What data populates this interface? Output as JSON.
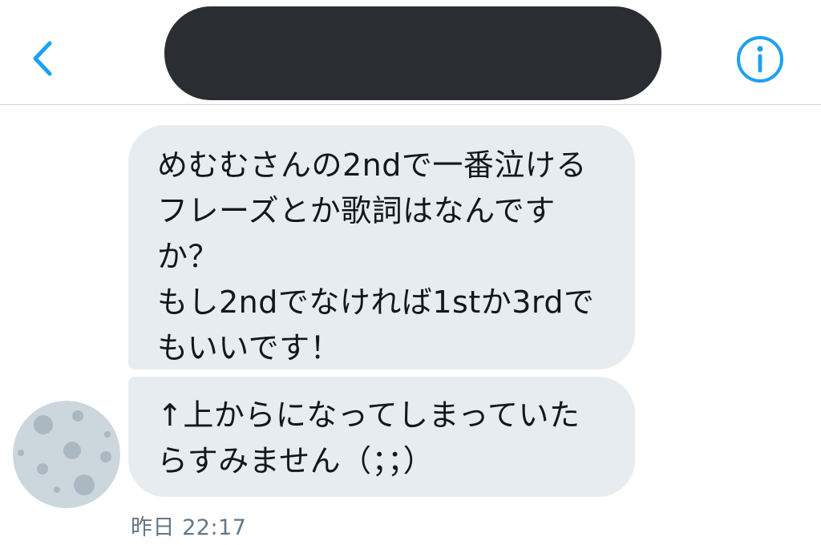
{
  "header": {
    "back_icon": "chevron-left-icon",
    "info_icon": "info-circle-icon",
    "accent_color": "#1da1f2"
  },
  "conversation": {
    "messages": [
      {
        "lines": [
          "めむむさんの2ndで一番泣ける",
          "フレーズとか歌詞はなんです",
          "か？",
          "もし2ndでなければ1stか3rdで",
          "もいいです！"
        ]
      },
      {
        "lines": [
          "↑上からになってしまっていた",
          "らすみません（；；）"
        ]
      }
    ],
    "timestamp": "昨日 22:17"
  },
  "colors": {
    "bubble_background": "#e6ecf0",
    "text": "#14171a",
    "timestamp": "#657786"
  }
}
